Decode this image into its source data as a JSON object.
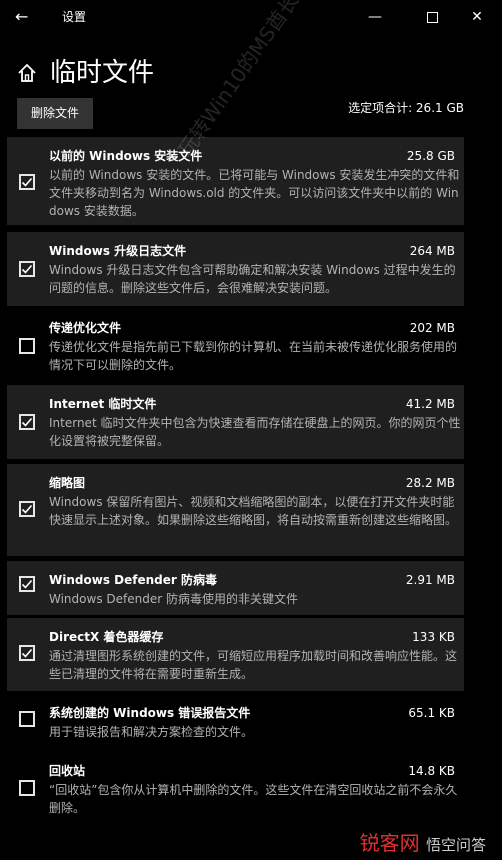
{
  "window": {
    "title": "设置",
    "back_icon": "arrow-left-icon",
    "minimize_icon": "minimize-icon",
    "maximize_icon": "maximize-icon",
    "close_icon": "close-icon"
  },
  "page": {
    "home_icon": "home-icon",
    "title": "临时文件",
    "delete_button": "删除文件",
    "total_label": "选定项合计: 26.1 GB"
  },
  "items": [
    {
      "name": "以前的 Windows 安装文件",
      "size": "25.8 GB",
      "checked": true,
      "desc": "以前的 Windows 安装的文件。已将可能与 Windows 安装发生冲突的文件和文件夹移动到名为 Windows.old 的文件夹。可以访问该文件夹中以前的 Windows 安装数据。"
    },
    {
      "name": "Windows 升级日志文件",
      "size": "264 MB",
      "checked": true,
      "desc": "Windows 升级日志文件包含可帮助确定和解决安装 Windows 过程中发生的问题的信息。删除这些文件后，会很难解决安装问题。"
    },
    {
      "name": "传递优化文件",
      "size": "202 MB",
      "checked": false,
      "desc": "传递优化文件是指先前已下载到你的计算机、在当前未被传递优化服务使用的情况下可以删除的文件。"
    },
    {
      "name": "Internet 临时文件",
      "size": "41.2 MB",
      "checked": true,
      "desc": "Internet 临时文件夹中包含为快速查看而存储在硬盘上的网页。你的网页个性化设置将被完整保留。"
    },
    {
      "name": "缩略图",
      "size": "28.2 MB",
      "checked": true,
      "desc": "Windows 保留所有图片、视频和文档缩略图的副本，以便在打开文件夹时能快速显示上述对象。如果删除这些缩略图，将自动按需重新创建这些缩略图。"
    },
    {
      "name": "Windows Defender 防病毒",
      "size": "2.91 MB",
      "checked": true,
      "desc": "Windows Defender 防病毒使用的非关键文件"
    },
    {
      "name": "DirectX 着色器缓存",
      "size": "133 KB",
      "checked": true,
      "desc": "通过清理图形系统创建的文件，可缩短应用程序加载时间和改善响应性能。这些已清理的文件将在需要时重新生成。"
    },
    {
      "name": "系统创建的 Windows 错误报告文件",
      "size": "65.1 KB",
      "checked": false,
      "desc": "用于错误报告和解决方案检查的文件。"
    },
    {
      "name": "回收站",
      "size": "14.8 KB",
      "checked": false,
      "desc": "“回收站”包含你从计算机中删除的文件。这些文件在清空回收站之前不会永久删除。"
    }
  ],
  "watermark": "玩转Win10的MS酋长",
  "footer": {
    "brand": "锐客网",
    "sub": "悟空问答"
  },
  "colors": {
    "background": "#000000",
    "item_bg": "#1f1f1f",
    "text": "#ffffff",
    "desc": "#b3b3b3",
    "button": "#333333"
  }
}
